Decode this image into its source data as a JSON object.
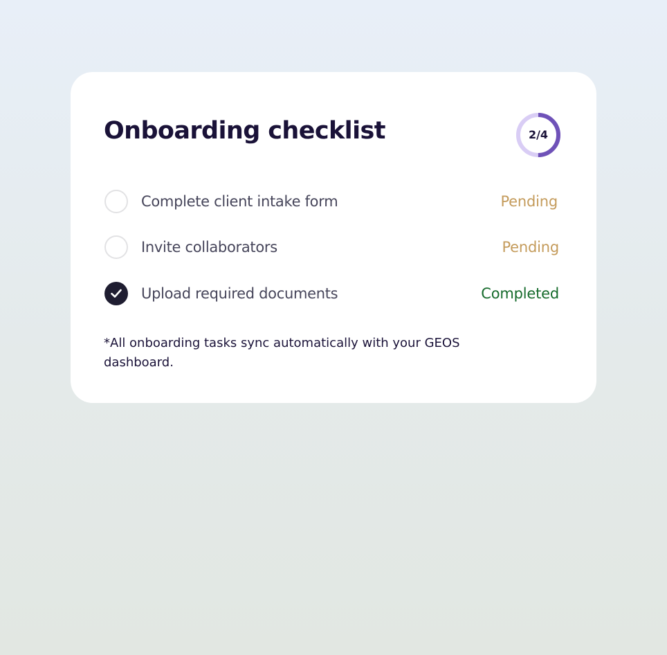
{
  "checklist": {
    "title": "Onboarding checklist",
    "progress": {
      "label": "2/4",
      "completed": 2,
      "total": 4,
      "ring_color": "#6f52b8",
      "track_color": "#d9cdf5"
    },
    "tasks": [
      {
        "label": "Complete client intake form",
        "status": "Pending",
        "done": false
      },
      {
        "label": "Invite collaborators",
        "status": "Pending",
        "done": false
      },
      {
        "label": "Upload required documents",
        "status": "Completed",
        "done": true
      }
    ],
    "footnote": "*All onboarding tasks sync automatically with your GEOS dashboard."
  },
  "icons": {
    "unchecked": "circle-outline-icon",
    "checked": "checkmark-circle-icon"
  },
  "colors": {
    "pending": "#c49b5b",
    "completed": "#166b2c",
    "title": "#1a1238",
    "check_fill": "#1f1d31"
  }
}
